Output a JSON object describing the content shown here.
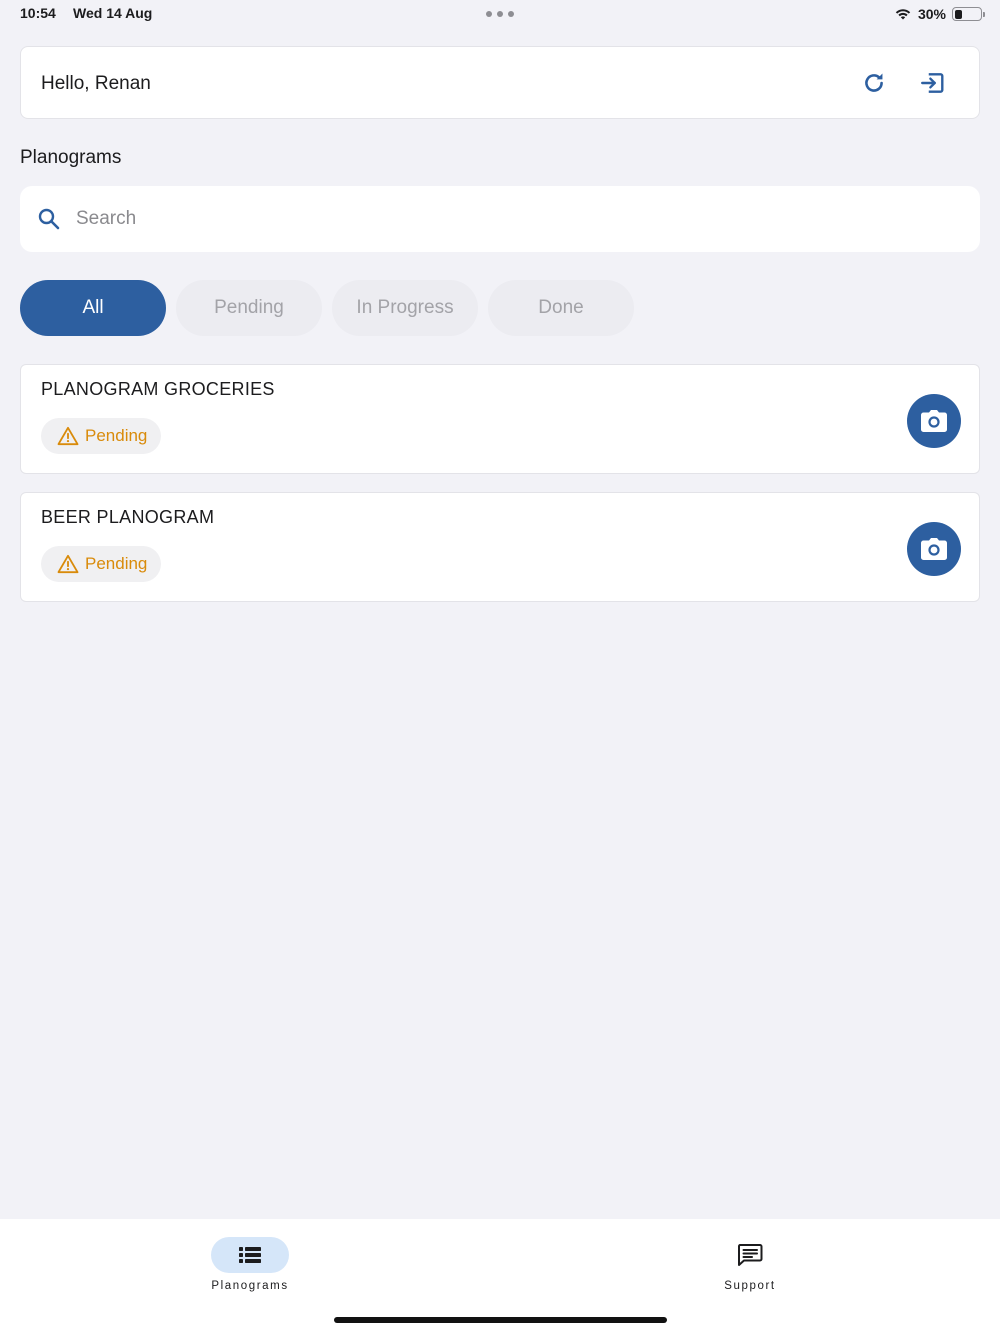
{
  "status_bar": {
    "time": "10:54",
    "date": "Wed 14 Aug",
    "battery_percent": "30%",
    "battery_level": 0.3
  },
  "header": {
    "greeting": "Hello, Renan",
    "refresh_icon": "refresh-icon",
    "logout_icon": "logout-icon"
  },
  "section_title": "Planograms",
  "search": {
    "placeholder": "Search",
    "value": ""
  },
  "filters": [
    {
      "label": "All",
      "active": true
    },
    {
      "label": "Pending",
      "active": false
    },
    {
      "label": "In Progress",
      "active": false
    },
    {
      "label": "Done",
      "active": false
    }
  ],
  "planograms": [
    {
      "title": "PLANOGRAM GROCERIES",
      "status": "Pending",
      "status_icon": "warning-icon",
      "action_icon": "camera-icon"
    },
    {
      "title": "BEER PLANOGRAM",
      "status": "Pending",
      "status_icon": "warning-icon",
      "action_icon": "camera-icon"
    }
  ],
  "bottom_nav": [
    {
      "label": "Planograms",
      "icon": "list-icon",
      "active": true
    },
    {
      "label": "Support",
      "icon": "chat-icon",
      "active": false
    }
  ],
  "colors": {
    "primary": "#2d5fa0",
    "pending": "#d98b0b",
    "background": "#f2f2f7",
    "nav_active_pill": "#d5e6f9"
  }
}
